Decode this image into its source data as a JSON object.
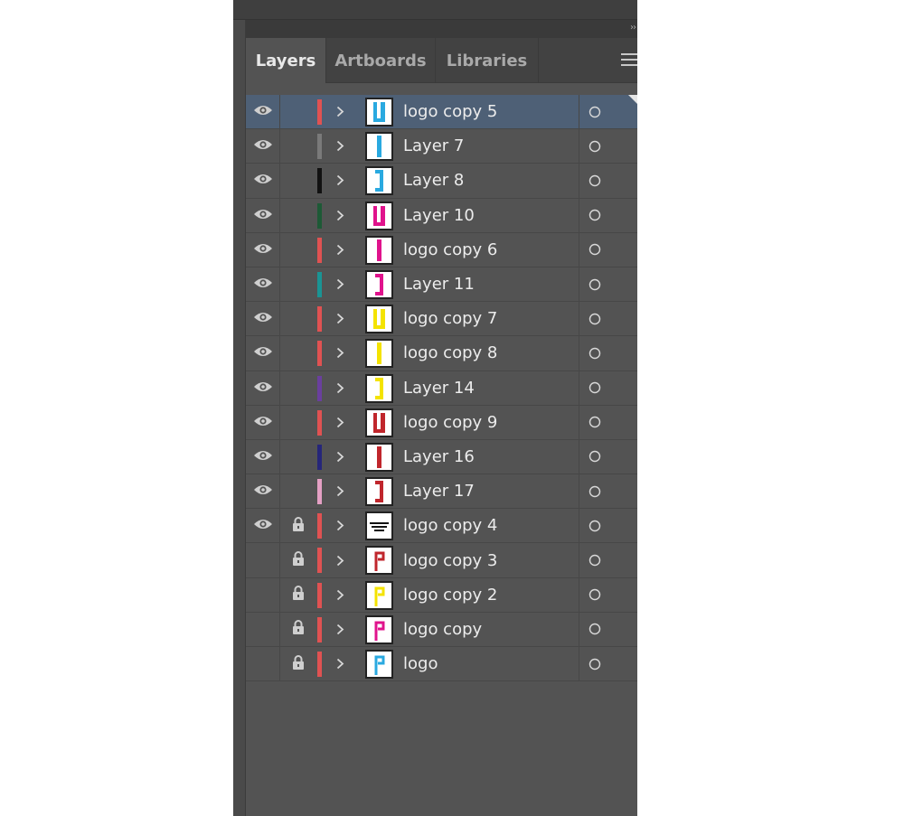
{
  "tabs": [
    {
      "label": "Layers",
      "active": true
    },
    {
      "label": "Artboards",
      "active": false
    },
    {
      "label": "Libraries",
      "active": false
    }
  ],
  "icons": {
    "collapse": "double-chevron-right-icon",
    "menu": "hamburger-menu-icon",
    "visibility": "eye-icon",
    "lock": "lock-icon",
    "expand": "chevron-right-icon",
    "target": "target-circle-icon"
  },
  "layers": [
    {
      "name": "logo copy 5",
      "visible": true,
      "locked": false,
      "color": "#e05252",
      "thumb": "double-bar",
      "thumb_color": "#29a9e0",
      "selected": true
    },
    {
      "name": "Layer 7",
      "visible": true,
      "locked": false,
      "color": "#7a7a7a",
      "thumb": "bar",
      "thumb_color": "#29a9e0",
      "selected": false
    },
    {
      "name": "Layer 8",
      "visible": true,
      "locked": false,
      "color": "#111111",
      "thumb": "bracket",
      "thumb_color": "#29a9e0",
      "selected": false
    },
    {
      "name": "Layer 10",
      "visible": true,
      "locked": false,
      "color": "#1d5a36",
      "thumb": "double-bar",
      "thumb_color": "#e0138c",
      "selected": false
    },
    {
      "name": "logo copy 6",
      "visible": true,
      "locked": false,
      "color": "#e05252",
      "thumb": "bar",
      "thumb_color": "#e0138c",
      "selected": false
    },
    {
      "name": "Layer 11",
      "visible": true,
      "locked": false,
      "color": "#1a9494",
      "thumb": "bracket",
      "thumb_color": "#e0138c",
      "selected": false
    },
    {
      "name": "logo copy 7",
      "visible": true,
      "locked": false,
      "color": "#e05252",
      "thumb": "double-bar",
      "thumb_color": "#f4e300",
      "selected": false
    },
    {
      "name": "logo copy 8",
      "visible": true,
      "locked": false,
      "color": "#e05252",
      "thumb": "bar",
      "thumb_color": "#f4e300",
      "selected": false
    },
    {
      "name": "Layer 14",
      "visible": true,
      "locked": false,
      "color": "#6a3f9e",
      "thumb": "bracket",
      "thumb_color": "#f4e300",
      "selected": false
    },
    {
      "name": "logo copy 9",
      "visible": true,
      "locked": false,
      "color": "#e05252",
      "thumb": "double-bar",
      "thumb_color": "#c0262c",
      "selected": false
    },
    {
      "name": "Layer 16",
      "visible": true,
      "locked": false,
      "color": "#26267a",
      "thumb": "bar",
      "thumb_color": "#c0262c",
      "selected": false
    },
    {
      "name": "Layer 17",
      "visible": true,
      "locked": false,
      "color": "#e4a0c4",
      "thumb": "bracket",
      "thumb_color": "#c0262c",
      "selected": false
    },
    {
      "name": "logo copy 4",
      "visible": true,
      "locked": true,
      "color": "#e05252",
      "thumb": "text",
      "thumb_color": "#111111",
      "selected": false
    },
    {
      "name": "logo copy 3",
      "visible": false,
      "locked": true,
      "color": "#e05252",
      "thumb": "p",
      "thumb_color": "#c0262c",
      "selected": false
    },
    {
      "name": "logo copy 2",
      "visible": false,
      "locked": true,
      "color": "#e05252",
      "thumb": "p",
      "thumb_color": "#f4e300",
      "selected": false
    },
    {
      "name": "logo copy",
      "visible": false,
      "locked": true,
      "color": "#e05252",
      "thumb": "p",
      "thumb_color": "#e0138c",
      "selected": false
    },
    {
      "name": "logo",
      "visible": false,
      "locked": true,
      "color": "#e05252",
      "thumb": "p",
      "thumb_color": "#29a9e0",
      "selected": false
    }
  ]
}
